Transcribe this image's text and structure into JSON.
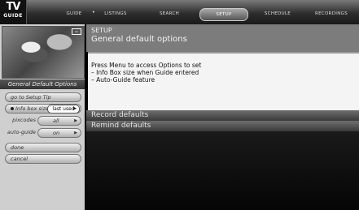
{
  "logo": {
    "line1": "TV",
    "line2": "GUIDE"
  },
  "nav": {
    "tabs": [
      {
        "label": "Guide",
        "active": false
      },
      {
        "label": "Listings",
        "active": false
      },
      {
        "label": "Search",
        "active": false
      },
      {
        "label": "Setup",
        "active": true
      },
      {
        "label": "Schedule",
        "active": false
      },
      {
        "label": "Recordings",
        "active": false
      }
    ]
  },
  "sidebar": {
    "menu_title": "General Default Options",
    "go_to_setup": "go to Setup Tip",
    "info_box": {
      "label": "Info box size",
      "value": "last used"
    },
    "pip": {
      "label": "pixcodes",
      "value": "all"
    },
    "auto_guide": {
      "label": "auto-guide",
      "value": "on"
    },
    "done": "done",
    "cancel": "cancel"
  },
  "main": {
    "breadcrumb": "SETUP",
    "section_title": "General default options",
    "body_lines": [
      "Press Menu to access Options to set",
      "– Info Box size when Guide entered",
      "– Auto-Guide feature"
    ],
    "bands": [
      "Record defaults",
      "Remind defaults"
    ]
  }
}
